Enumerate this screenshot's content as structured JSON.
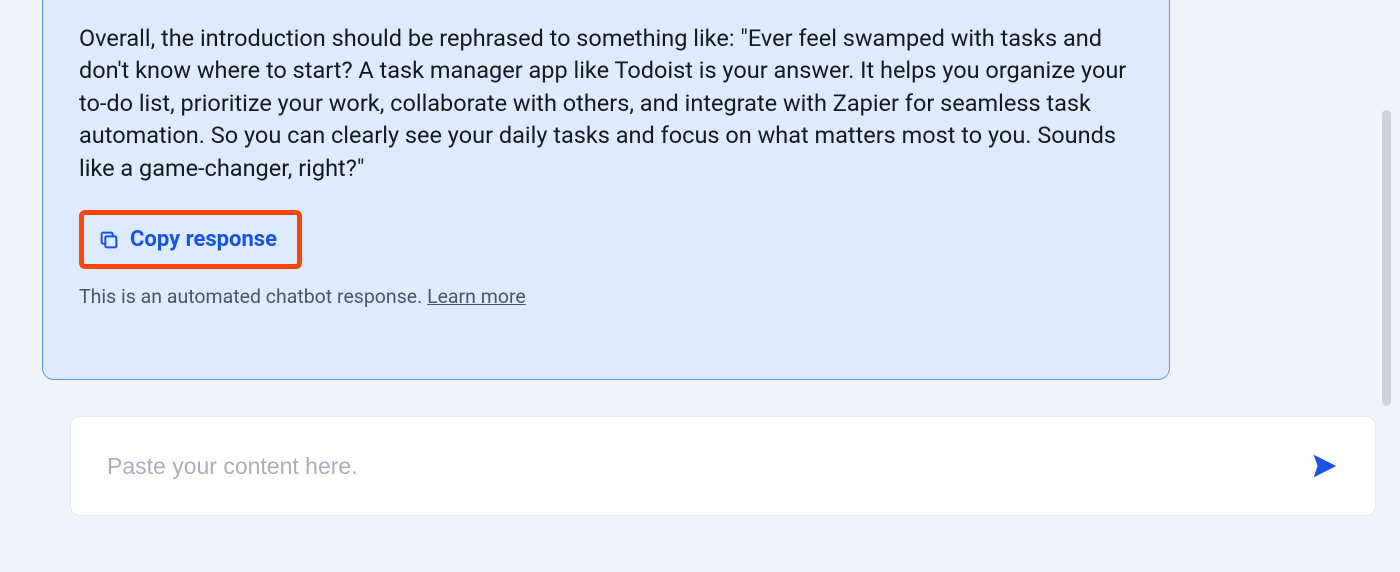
{
  "response": {
    "text": "Overall, the introduction should be rephrased to something like: \"Ever feel swamped with tasks and don't know where to start? A task manager app like Todoist is your answer. It helps you organize your to-do list, prioritize your work, collaborate with others, and integrate with Zapier for seamless task automation. So you can clearly see your daily tasks and focus on what matters most to you. Sounds like a game-changer, right?\"",
    "copy_label": "Copy response",
    "disclaimer_text": "This is an automated chatbot response. ",
    "learn_more_label": "Learn more"
  },
  "composer": {
    "placeholder": "Paste your content here."
  },
  "icons": {
    "copy": "copy-icon",
    "send": "send-icon"
  },
  "colors": {
    "accent": "#1953e6",
    "highlight_border": "#ff4600",
    "bubble_bg": "#deebfd",
    "bubble_border": "#5f99ef"
  }
}
